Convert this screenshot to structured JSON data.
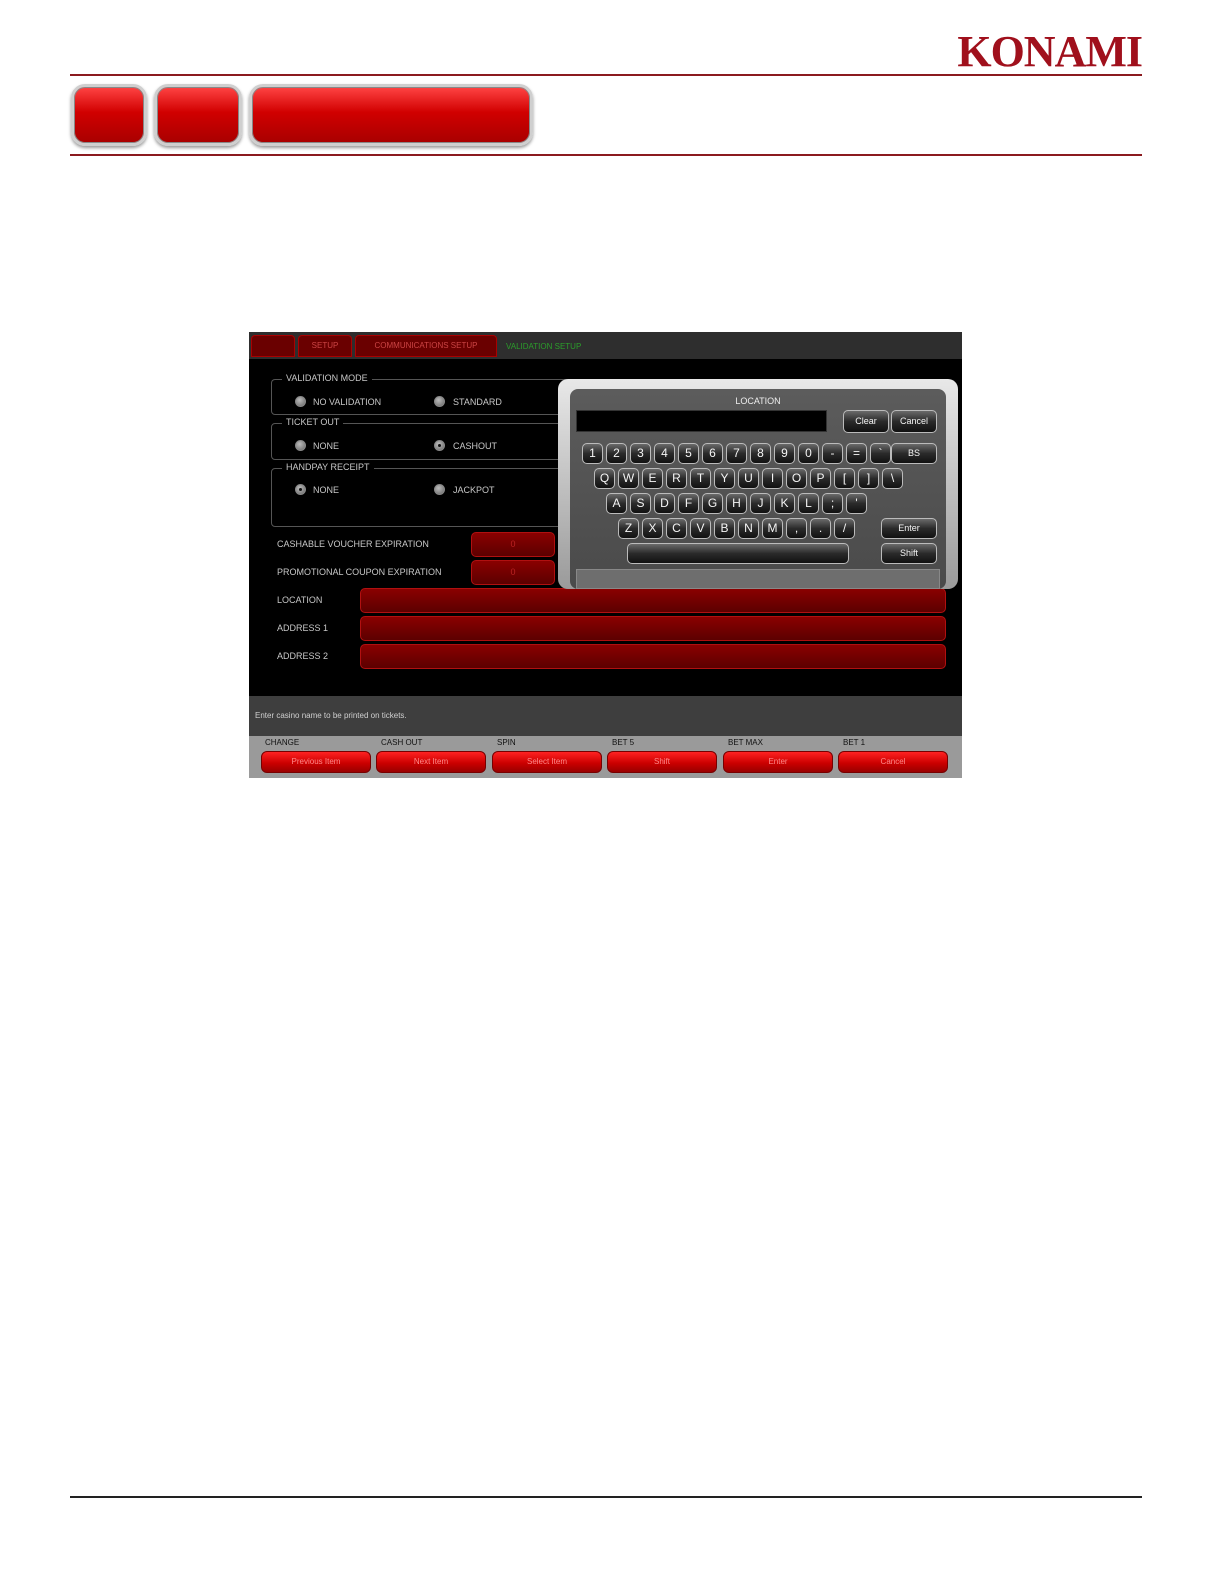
{
  "document": {
    "brand": "KONAMI"
  },
  "screen": {
    "tabs": [
      "",
      "SETUP",
      "COMMUNICATIONS SETUP"
    ],
    "active_tab_label": "VALIDATION SETUP",
    "validation_mode": {
      "legend": "VALIDATION MODE",
      "options": [
        {
          "label": "NO VALIDATION",
          "selected": false
        },
        {
          "label": "STANDARD",
          "selected": false
        }
      ]
    },
    "ticket_out": {
      "legend": "TICKET OUT",
      "options": [
        {
          "label": "NONE",
          "selected": false
        },
        {
          "label": "CASHOUT",
          "selected": true
        }
      ]
    },
    "handpay_receipt": {
      "legend": "HANDPAY RECEIPT",
      "options": [
        {
          "label": "NONE",
          "selected": true
        },
        {
          "label": "JACKPOT",
          "selected": false
        }
      ]
    },
    "fields": {
      "cashable_voucher_expiration": {
        "label": "CASHABLE VOUCHER EXPIRATION",
        "value": "0"
      },
      "promotional_coupon_expiration": {
        "label": "PROMOTIONAL COUPON EXPIRATION",
        "value": "0"
      },
      "location": {
        "label": "LOCATION",
        "value": ""
      },
      "address1": {
        "label": "ADDRESS 1",
        "value": ""
      },
      "address2": {
        "label": "ADDRESS 2",
        "value": ""
      }
    },
    "hint": "Enter casino name to be printed on tickets.",
    "buttons": [
      {
        "caption": "CHANGE",
        "label": "Previous Item"
      },
      {
        "caption": "CASH OUT",
        "label": "Next Item"
      },
      {
        "caption": "SPIN",
        "label": "Select Item"
      },
      {
        "caption": "BET 5",
        "label": "Shift"
      },
      {
        "caption": "BET MAX",
        "label": "Enter"
      },
      {
        "caption": "BET 1",
        "label": "Cancel"
      }
    ],
    "keyboard": {
      "title": "LOCATION",
      "display_value": "",
      "clear": "Clear",
      "cancel": "Cancel",
      "enter": "Enter",
      "shift": "Shift",
      "backspace": "BS",
      "rows": [
        [
          "1",
          "2",
          "3",
          "4",
          "5",
          "6",
          "7",
          "8",
          "9",
          "0",
          "-",
          "=",
          "`"
        ],
        [
          "Q",
          "W",
          "E",
          "R",
          "T",
          "Y",
          "U",
          "I",
          "O",
          "P",
          "[",
          "]",
          "\\"
        ],
        [
          "A",
          "S",
          "D",
          "F",
          "G",
          "H",
          "J",
          "K",
          "L",
          ";",
          "'"
        ],
        [
          "Z",
          "X",
          "C",
          "V",
          "B",
          "N",
          "M",
          ",",
          ".",
          "/"
        ]
      ]
    }
  }
}
